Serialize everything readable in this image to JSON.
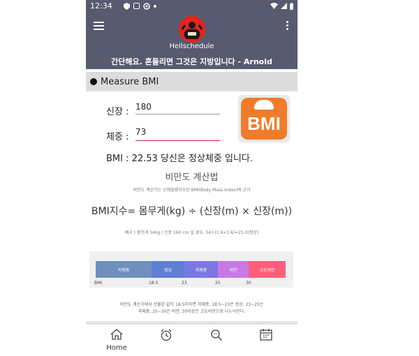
{
  "status": {
    "time": "12:34"
  },
  "app": {
    "name": "Hellschedule",
    "quote": "간단해요. 흔들리면 그것은 지방입니다 - Arnold"
  },
  "section": {
    "title": "Measure BMI"
  },
  "form": {
    "height_label": "신장 :",
    "height_value": "180",
    "weight_label": "체중 :",
    "weight_value": "73"
  },
  "badge": {
    "text": "BMI"
  },
  "result": {
    "text": "BMI : 22.53 당신은 정상체중 입니다."
  },
  "info": {
    "title": "비만도 계산법",
    "subtitle": "비만도 계산기는 신체질량지수인 BMI(Body Mass Index)에 근거",
    "formula": "BMI지수= 몸무게(kg) ÷ (신장(m) × 신장(m))",
    "example": "예시 ) 몸무게 54kg / 신장 160 cm 일 경우, 54÷(1.6×1.6)=21.0(정상)",
    "scale": [
      {
        "label": "저체중",
        "color": "#6f8fbd"
      },
      {
        "label": "정상",
        "color": "#5f7fd4"
      },
      {
        "label": "과체중",
        "color": "#7a78e0"
      },
      {
        "label": "비만",
        "color": "#c77ae6"
      },
      {
        "label": "고도비만",
        "color": "#ff5f7a"
      }
    ],
    "scale_start": "BMI",
    "ticks": [
      "18.5",
      "23",
      "25",
      "30"
    ],
    "footnote_1": "비만도 계산기에서 산출된 값이 18.5이하면 저체중, 18.5~23은 정상, 23~25는",
    "footnote_2": "과체중, 25~30은 비만, 30이상은 고도비만으로 나누어진다."
  },
  "nav": {
    "home_label": "Home"
  },
  "colors": {
    "appbar": "#585a70",
    "accent": "#d0245a",
    "badge": "#f07c2a"
  }
}
